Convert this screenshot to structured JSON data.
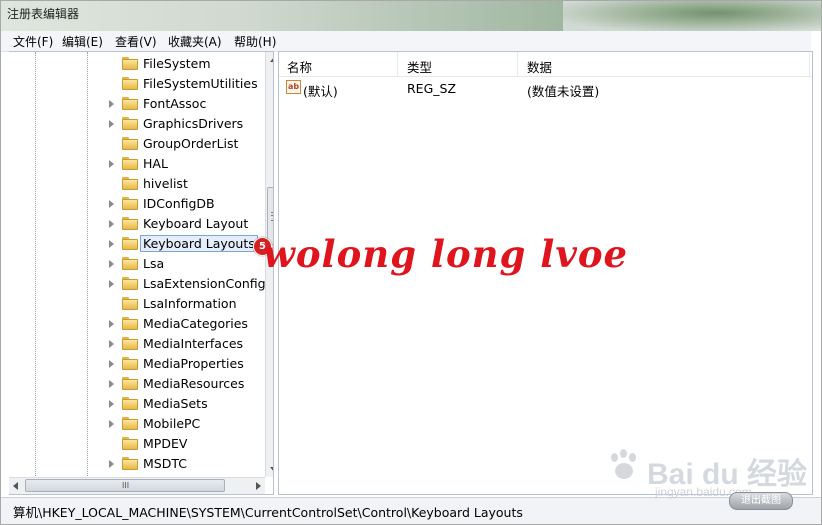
{
  "window": {
    "title": "注册表编辑器"
  },
  "menu": [
    "文件(F)",
    "编辑(E)",
    "查看(V)",
    "收藏夹(A)",
    "帮助(H)"
  ],
  "tree": {
    "items": [
      {
        "label": "FileSystem",
        "expandable": false
      },
      {
        "label": "FileSystemUtilities",
        "expandable": false
      },
      {
        "label": "FontAssoc",
        "expandable": true
      },
      {
        "label": "GraphicsDrivers",
        "expandable": true
      },
      {
        "label": "GroupOrderList",
        "expandable": false
      },
      {
        "label": "HAL",
        "expandable": true
      },
      {
        "label": "hivelist",
        "expandable": false
      },
      {
        "label": "IDConfigDB",
        "expandable": true
      },
      {
        "label": "Keyboard Layout",
        "expandable": true
      },
      {
        "label": "Keyboard Layouts",
        "expandable": true,
        "selected": true
      },
      {
        "label": "Lsa",
        "expandable": true
      },
      {
        "label": "LsaExtensionConfig",
        "expandable": true
      },
      {
        "label": "LsaInformation",
        "expandable": false
      },
      {
        "label": "MediaCategories",
        "expandable": true
      },
      {
        "label": "MediaInterfaces",
        "expandable": true
      },
      {
        "label": "MediaProperties",
        "expandable": true
      },
      {
        "label": "MediaResources",
        "expandable": true
      },
      {
        "label": "MediaSets",
        "expandable": true
      },
      {
        "label": "MobilePC",
        "expandable": true
      },
      {
        "label": "MPDEV",
        "expandable": false
      },
      {
        "label": "MSDTC",
        "expandable": true
      }
    ],
    "hscroll_grip": "III"
  },
  "list": {
    "columns": [
      "名称",
      "类型",
      "数据"
    ],
    "rows": [
      {
        "icon": "ab",
        "name": "(默认)",
        "type": "REG_SZ",
        "data": "(数值未设置)"
      }
    ]
  },
  "status": {
    "path": "算机\\HKEY_LOCAL_MACHINE\\SYSTEM\\CurrentControlSet\\Control\\Keyboard Layouts"
  },
  "overlay": {
    "step_badge": "5",
    "watermark": "wolong long lvoe",
    "baidu_logo": "Bai du 经验",
    "baidu_url": "jingyan.baidu.com",
    "exit_button": "退出截图"
  },
  "colors": {
    "watermark": "#e0141d",
    "badge": "#d32222",
    "selection": "#e4eefb"
  }
}
